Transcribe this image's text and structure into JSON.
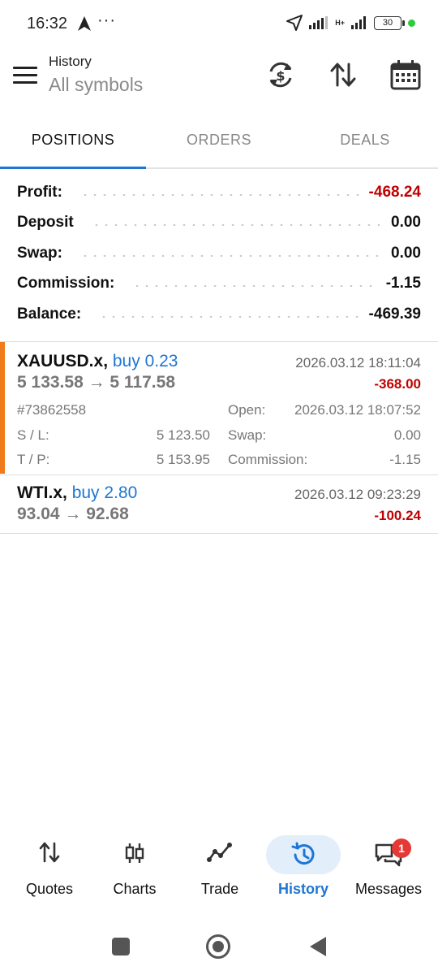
{
  "status_bar": {
    "time": "16:32",
    "dots": "···",
    "network": "H+",
    "battery": "30"
  },
  "header": {
    "section": "History",
    "filter": "All symbols"
  },
  "tabs": [
    {
      "label": "POSITIONS",
      "active": true
    },
    {
      "label": "ORDERS",
      "active": false
    },
    {
      "label": "DEALS",
      "active": false
    }
  ],
  "summary": {
    "profit_label": "Profit:",
    "profit_value": "-468.24",
    "deposit_label": "Deposit",
    "deposit_value": "0.00",
    "swap_label": "Swap:",
    "swap_value": "0.00",
    "commission_label": "Commission:",
    "commission_value": "-1.15",
    "balance_label": "Balance:",
    "balance_value": "-469.39"
  },
  "positions": [
    {
      "symbol": "XAUUSD.x,",
      "side": "buy 0.23",
      "close_time": "2026.03.12 18:11:04",
      "prices": "5 133.58 → 5 117.58",
      "profit": "-368.00",
      "ticket": "#73862558",
      "open_label": "Open:",
      "open_time": "2026.03.12 18:07:52",
      "sl_label": "S / L:",
      "sl_value": "5 123.50",
      "swap_label": "Swap:",
      "swap_value": "0.00",
      "tp_label": "T / P:",
      "tp_value": "5 153.95",
      "commission_label": "Commission:",
      "commission_value": "-1.15"
    },
    {
      "symbol": "WTI.x,",
      "side": "buy 2.80",
      "close_time": "2026.03.12 09:23:29",
      "prices": "93.04 → 92.68",
      "profit": "-100.24"
    }
  ],
  "bottom_nav": [
    {
      "label": "Quotes",
      "icon": "quotes-arrows-icon"
    },
    {
      "label": "Charts",
      "icon": "candlestick-icon"
    },
    {
      "label": "Trade",
      "icon": "trade-line-icon"
    },
    {
      "label": "History",
      "icon": "history-clock-icon",
      "active": true
    },
    {
      "label": "Messages",
      "icon": "chat-icon",
      "badge": "1"
    }
  ],
  "colors": {
    "accent_blue": "#1e76d3",
    "loss_red": "#c00000",
    "position_marker": "#f07b1a",
    "badge_red": "#e53935"
  }
}
